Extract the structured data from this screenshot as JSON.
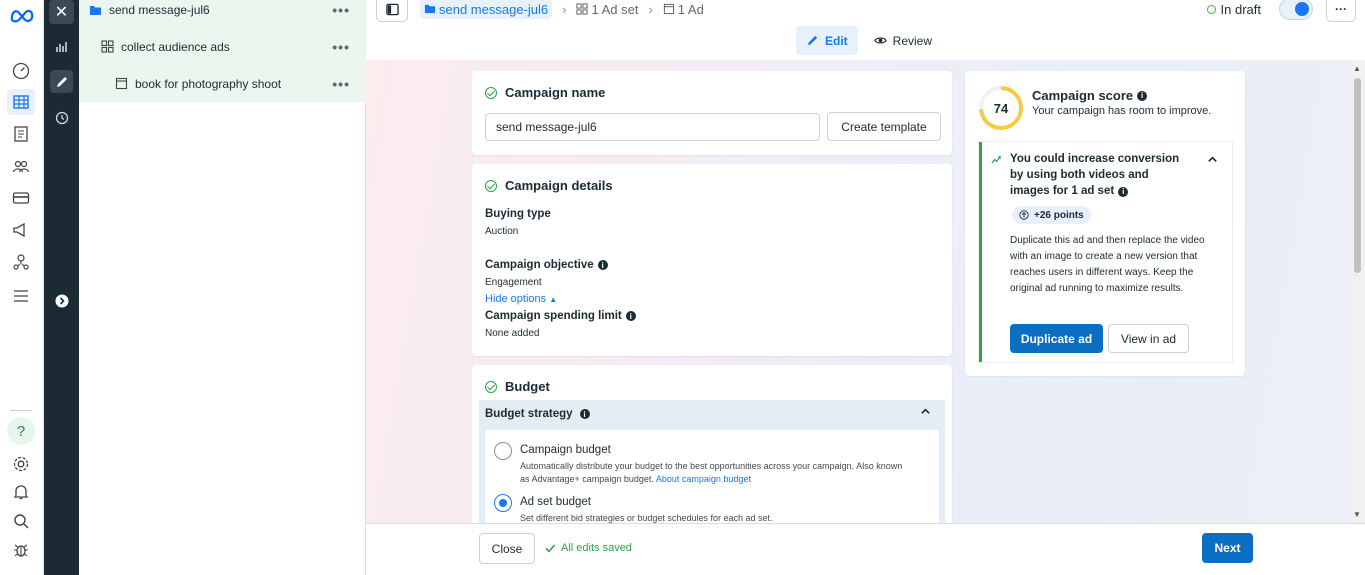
{
  "rail": {
    "icons": [
      "meta-logo-icon",
      "dashboard-icon",
      "table-icon",
      "pages-icon",
      "audiences-icon",
      "billing-icon",
      "ads-icon",
      "business-icon",
      "menu-icon",
      "help-icon",
      "settings-icon",
      "bell-icon",
      "search-icon",
      "bug-icon"
    ],
    "help_glyph": "?"
  },
  "tree": {
    "campaign": "send message-jul6",
    "adset": "collect audience ads",
    "ad": "book for photography shoot",
    "more_glyph": "•••"
  },
  "topbar": {
    "breadcrumbs": [
      "send message-jul6",
      "1 Ad set",
      "1 Ad"
    ],
    "status": "In draft",
    "more_glyph": "···",
    "tabs": {
      "edit": "Edit",
      "review": "Review"
    }
  },
  "campaign_name": {
    "title": "Campaign name",
    "value": "send message-jul6",
    "create_template": "Create template"
  },
  "campaign_details": {
    "title": "Campaign details",
    "buying_type_label": "Buying type",
    "buying_type_value": "Auction",
    "objective_label": "Campaign objective",
    "objective_value": "Engagement",
    "hide_options": "Hide options",
    "spending_limit_label": "Campaign spending limit",
    "spending_limit_value": "None added"
  },
  "budget": {
    "title": "Budget",
    "strategy_label": "Budget strategy",
    "options": [
      {
        "title": "Campaign budget",
        "desc": "Automatically distribute your budget to the best opportunities across your campaign. Also known as Advantage+ campaign budget.",
        "link": "About campaign budget",
        "selected": false
      },
      {
        "title": "Ad set budget",
        "desc": "Set different bid strategies or budget schedules for each ad set.",
        "selected": true
      }
    ]
  },
  "score": {
    "value": "74",
    "fill_percent": 74,
    "title": "Campaign score",
    "subtitle": "Your campaign has room to improve.",
    "rec_title": "You could increase conversion by using both videos and images for 1 ad set",
    "points": "+26 points",
    "rec_body": "Duplicate this ad and then replace the video with an image to create a new version that reaches users in different ways. Keep the original ad running to maximize results.",
    "duplicate": "Duplicate ad",
    "view": "View in ad"
  },
  "footer": {
    "close": "Close",
    "saved": "All edits saved",
    "next": "Next"
  },
  "colors": {
    "accent": "#1877f2",
    "primary_button": "#0b6ec2",
    "success": "#31a24c",
    "dark_nav": "#1c2b33"
  }
}
